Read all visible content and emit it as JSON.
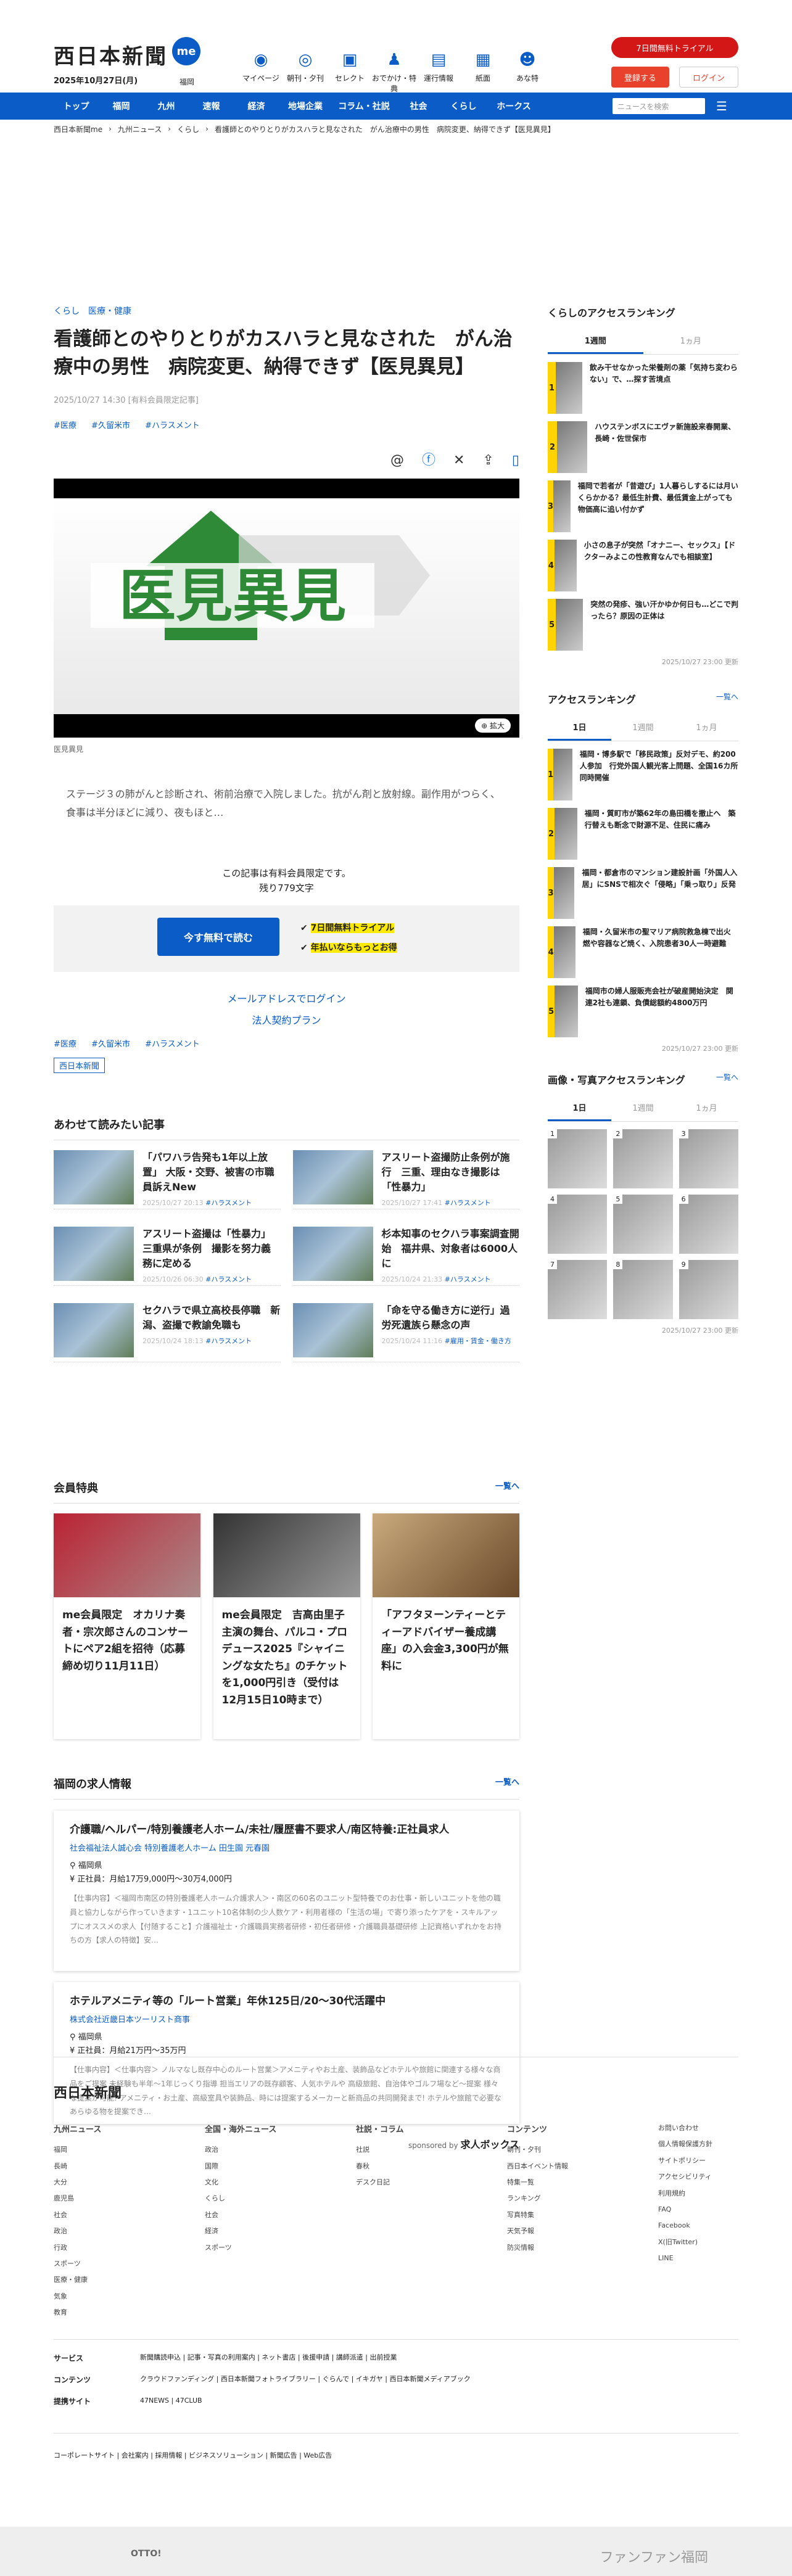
{
  "header": {
    "logo": "西日本新聞",
    "me": "me",
    "date": "2025年10月27日(月)",
    "fukuoka": "福岡",
    "nav": [
      {
        "label": "マイページ",
        "icon": "me-icon"
      },
      {
        "label": "朝刊・夕刊",
        "icon": "newspaper-icon"
      },
      {
        "label": "セレクト",
        "icon": "select-icon"
      },
      {
        "label": "おでかけ・特典",
        "icon": "outing-icon"
      },
      {
        "label": "運行情報",
        "icon": "train-icon"
      },
      {
        "label": "紙面",
        "icon": "paper-icon"
      },
      {
        "label": "あな特",
        "icon": "anatoku-icon"
      }
    ],
    "trial": "7日間無料トライアル",
    "register": "登録する",
    "login": "ログイン"
  },
  "gnav": {
    "items": [
      "トップ",
      "福岡",
      "九州",
      "速報",
      "経済",
      "地場企業",
      "コラム・社説",
      "社会",
      "くらし",
      "ホークス"
    ],
    "search_placeholder": "ニュースを検索",
    "menu": "カテゴリ一覧"
  },
  "breadcrumb": [
    "西日本新聞me",
    "九州ニュース",
    "くらし",
    "看護師とのやりとりがカスハラと見なされた　がん治療中の男性　病院変更、納得できず【医見異見】"
  ],
  "article": {
    "category": "くらし　医療・健康",
    "title": "看護師とのやりとりがカスハラと見なされた　がん治療中の男性　病院変更、納得できず【医見異見】",
    "meta": "2025/10/27 14:30 [有料会員限定記事]",
    "tags": [
      "#医療",
      "#久留米市",
      "#ハラスメント"
    ],
    "photo_text": "医見異見",
    "zoom": "拡大",
    "caption": "医見異見",
    "lead": "ステージ３の肺がんと診断され、術前治療で入院しました。抗がん剤と放射線。副作用がつらく、食事は半分ほどに減り、夜もほと…",
    "paywall_line1": "この記事は有料会員限定です。",
    "paywall_line2": "残り779文字",
    "start_button": "今す無料で読む",
    "benefit1": "7日間無料トライアル",
    "benefit2": "年払いならもっとお得",
    "mail_login": "メールアドレスでログイン",
    "corp_plan": "法人契約プラン",
    "bottom_tags": [
      "#医療",
      "#久留米市",
      "#ハラスメント"
    ],
    "kind": "西日本新聞"
  },
  "related": {
    "heading": "あわせて読みたい記事",
    "items": [
      {
        "title": "「パワハラ告発も1年以上放置」 大阪・交野、被害の市職員訴えNew",
        "meta": "2025/10/27 20:13",
        "tag": "#ハラスメント"
      },
      {
        "title": "アスリート盗撮防止条例が施行　三重、理由なき撮影は「性暴力」",
        "meta": "2025/10/27 17:41",
        "tag": "#ハラスメント"
      },
      {
        "title": "アスリート盗撮は「性暴力」三重県が条例　撮影を努力義務に定める",
        "meta": "2025/10/26 06:30",
        "tag": "#ハラスメント"
      },
      {
        "title": "杉本知事のセクハラ事案調査開始　福井県、対象者は6000人に",
        "meta": "2025/10/24 21:33",
        "tag": "#ハラスメント"
      },
      {
        "title": "セクハラで県立高校長停職　新潟、盗撮で教諭免職も",
        "meta": "2025/10/24 18:13",
        "tag": "#ハラスメント"
      },
      {
        "title": "「命を守る働き方に逆行」過労死遺族ら懸念の声",
        "meta": "2025/10/24 11:16",
        "tag": "#雇用・賃金・働き方"
      }
    ]
  },
  "perks": {
    "heading": "会員特典",
    "more": "一覧へ",
    "items": [
      "me会員限定　オカリナ奏者・宗次郎さんのコンサートにペア2組を招待（応募締め切り11月11日）",
      "me会員限定　吉高由里子主演の舞台、パルコ・プロデュース2025『シャイニングな女たち』のチケットを1,000円引き（受付は12月15日10時まで）",
      "「アフタヌーンティーとティーアドバイザー養成講座」の入会金3,300円が無料に"
    ]
  },
  "jobs": {
    "heading": "福岡の求人情報",
    "more": "一覧へ",
    "items": [
      {
        "title": "介護職/ヘルパー/特別養護老人ホーム/未社/履歴書不要求人/南区特養:正社員求人",
        "company": "社会福祉法人誠心会 特別養護老人ホーム 田生園 元春園",
        "loc": "福岡県",
        "salary": "正社員：月給17万9,000円〜30万4,000円",
        "desc": "【仕事内容】＜福岡市南区の特別養護老人ホーム介護求人＞・南区の60名のユニット型特養でのお仕事・新しいユニットを他の職員と協力しながら作っていきます・1ユニット10名体制の少人数ケア・利用者様の「生活の場」で寄り添ったケアを・スキルアップにオススメの求人【付随すること】介護福祉士・介護職員実務者研修・初任者研修・介護職員基礎研修 上記資格いずれかをお持ちの方【求人の特徴】安…"
      },
      {
        "title": "ホテルアメニティ等の「ルート営業」年休125日/20〜30代活躍中",
        "company": "株式会社近畿日本ツーリスト商事",
        "loc": "福岡県",
        "salary": "正社員：月給21万円〜35万円",
        "desc": "【仕事内容】＜仕事内容＞ ノルマなし既存中心のルート営業＞アメニティやお土産、装飾品などホテルや旅館に関連する様々な商品をご提案 未経験も半年〜1年じっくり指導 担当エリアの既存顧客、人気ホテルや 高級旅館、自治体やゴルフ場など〜提案 様々な提案が可能! アメニティ・お土産、高級室具や装飾品、時には提案するメーカーと新商品の共同開発まで! ホテルや旅館で必要なあらゆる物を提案でき…"
      }
    ],
    "sponsored": "sponsored by",
    "sponsor": "求人ボックス"
  },
  "side": {
    "rank1_heading": "くらしのアクセスランキング",
    "tabs1": [
      "1週間",
      "1ヵ月"
    ],
    "rank1": [
      "飲み干せなかった栄養剤の薬「気持ち変わらない」で、…探す苦境点",
      "ハウステンボスにエヴァ新施設来春開業、長崎・佐世保市",
      "福岡で若者が「昔遊び」1人暮らしするには月いくらかかる？最低生計費、最低賃金上がっても物価高に追い付かず",
      "小さの息子が突然「オナニー、セックス」【ドクターみよこの性教育なんでも相談室】",
      "突然の発疹、強い汗かゆか何日も…どこで判ったら？原因の正体は"
    ],
    "rank1_upd": "2025/10/27 23:00 更新",
    "rank2_heading": "アクセスランキング",
    "rank2_more": "一覧へ",
    "tabs2": [
      "1日",
      "1週間",
      "1ヵ月"
    ],
    "rank2": [
      "福岡・博多駅で「移民政策」反対デモ、約200人参加　行党外国人観光客上問題、全国16カ所同時開催",
      "福岡・質町市が築62年の島田橋を撤止へ　築行替えも断念で財源不足、住民に痛み",
      "福岡・都倉市のマンション建設計画「外国人入居」にSNSで相次ぐ「侵略」「乗っ取り」反発",
      "福岡・久留米市の聖マリア病院救急棟で出火　燃や容器など焼く、入院患者30人一時避難",
      "福岡市の婦人服販売会社が破産開始決定　関連2社も連鎖、負債総額約4800万円"
    ],
    "rank2_upd": "2025/10/27 23:00 更新",
    "rank3_heading": "画像・写真アクセスランキング",
    "rank3_more": "一覧へ",
    "tabs3": [
      "1日",
      "1週間",
      "1ヵ月"
    ],
    "rank3_upd": "2025/10/27 23:00 更新"
  },
  "footer": {
    "logo": "西日本新聞",
    "cols": [
      {
        "h": "九州ニュース",
        "items": [
          "福岡",
          "長崎",
          "大分",
          "鹿児島",
          "社会",
          "政治",
          "行政",
          "スポーツ",
          "医療・健康",
          "気象",
          "教育"
        ]
      },
      {
        "h": "全国・海外ニュース",
        "items": [
          "政治",
          "国際",
          "文化",
          "くらし",
          "社会",
          "経済",
          "スポーツ"
        ]
      },
      {
        "h": "社説・コラム",
        "items": [
          "社説",
          "春秋",
          "デスク日記"
        ]
      },
      {
        "h": "コンテンツ",
        "items": [
          "朝刊・夕刊",
          "西日本イベント情報",
          "特集一覧",
          "ランキング",
          "写真特集",
          "天気予報",
          "防災情報"
        ]
      },
      {
        "h": "",
        "items": [
          "お問い合わせ",
          "個人情報保護方針",
          "サイトポリシー",
          "アクセシビリティ",
          "利用規約",
          "FAQ",
          "Facebook",
          "X(旧Twitter)",
          "LINE"
        ]
      }
    ],
    "service": "サービス",
    "service_items": "新聞購読申込 | 記事・写真の利用案内 | ネット書店 | 後援申請 | 講師派遣 | 出前授業",
    "contents": "コンテンツ",
    "contents_items": "クラウドファンディング | 西日本新聞フォトライブラリー | ぐらんで | イキガヤ | 西日本新聞メディアブック",
    "site": "提携サイト",
    "site_items": "47NEWS | 47CLUB",
    "corp": "コーポレートサイト | 会社案内 | 採用情報 | ビジネスソリューション | 新聞広告 | Web広告",
    "bottom_left": "OTTO!",
    "bottom_right": "ファンファン福岡"
  }
}
